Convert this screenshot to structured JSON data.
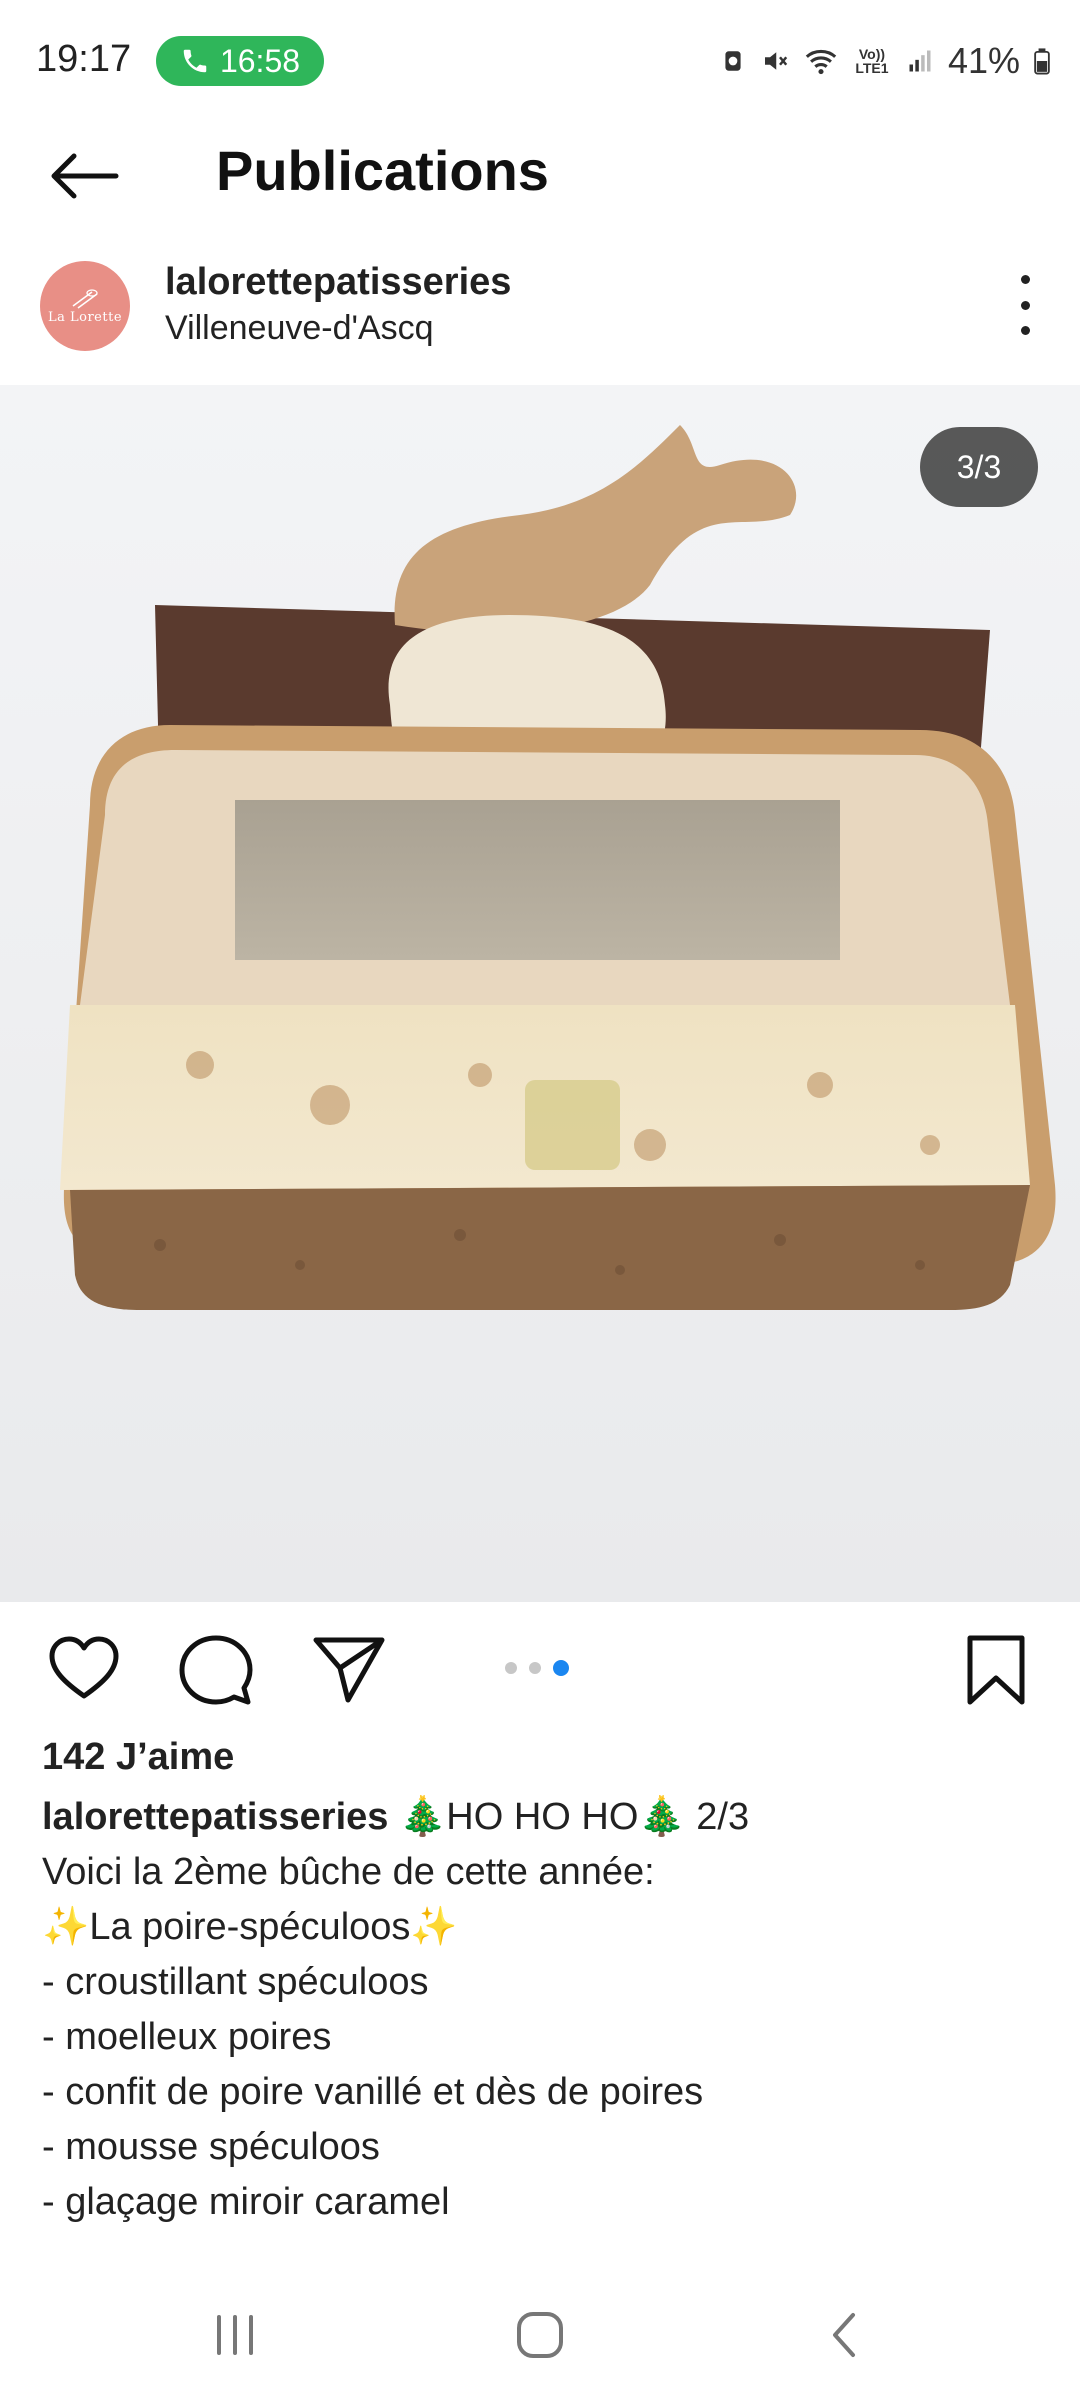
{
  "status": {
    "time": "19:17",
    "call_timer": "16:58",
    "volte_label": "Vo)) LTE1",
    "battery": "41%"
  },
  "appbar": {
    "title": "Publications"
  },
  "post": {
    "username": "lalorettepatisseries",
    "location": "Villeneuve-d'Ascq",
    "avatar_text": "La Lorette",
    "image_counter": "3/3",
    "carousel_total": 3,
    "carousel_active": 3,
    "likes": "142 J’aime",
    "caption": {
      "user": "lalorettepatisseries",
      "first_line_rest": " 🎄HO HO HO🎄 2/3",
      "lines": [
        "Voici la 2ème bûche de cette année:",
        "✨La poire-spéculoos✨",
        "- croustillant spéculoos",
        "- moelleux poires",
        "- confit de poire vanillé et dès de poires",
        "- mousse spéculoos",
        "- glaçage miroir caramel"
      ]
    }
  },
  "icons": {
    "back": "arrow-left-icon",
    "more": "more-vertical-icon",
    "like": "heart-icon",
    "comment": "comment-icon",
    "share": "send-icon",
    "save": "bookmark-icon"
  },
  "colors": {
    "call_pill": "#2fb65a",
    "carousel_active": "#1a86f0",
    "avatar_bg": "#e88f86"
  }
}
